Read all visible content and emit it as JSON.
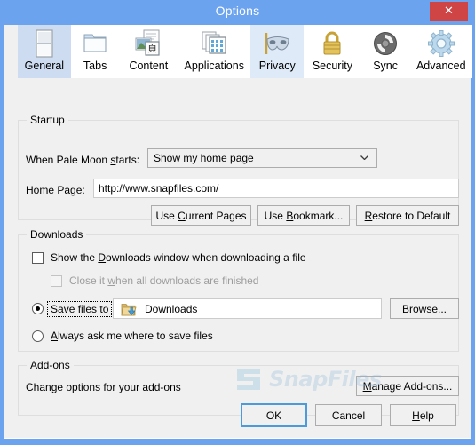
{
  "window": {
    "title": "Options",
    "close_label": "✕",
    "accent_titlebar": "#6ba3ef",
    "background": "#f0f0f0",
    "default_button_accent": "#4b9bdc",
    "close_button_color": "#cf4545"
  },
  "tabs": [
    {
      "label": "General",
      "icon": "general-page-icon",
      "state": "selected"
    },
    {
      "label": "Tabs",
      "icon": "folder-tabs-icon",
      "state": "normal"
    },
    {
      "label": "Content",
      "icon": "content-page-icon",
      "state": "normal"
    },
    {
      "label": "Applications",
      "icon": "applications-icon",
      "state": "normal"
    },
    {
      "label": "Privacy",
      "icon": "privacy-mask-icon",
      "state": "hover"
    },
    {
      "label": "Security",
      "icon": "security-lock-icon",
      "state": "normal"
    },
    {
      "label": "Sync",
      "icon": "sync-arrows-icon",
      "state": "normal"
    },
    {
      "label": "Advanced",
      "icon": "advanced-gear-icon",
      "state": "normal"
    }
  ],
  "startup": {
    "group_title": "Startup",
    "when_starts_label_pre": "When Pale Moon ",
    "when_starts_label_accel": "s",
    "when_starts_label_post": "tarts:",
    "startup_value": "Show my home page",
    "home_page_label_pre": "Home ",
    "home_page_label_accel": "P",
    "home_page_label_post": "age:",
    "home_page_value": "http://www.snapfiles.com/",
    "use_current_pages_pre": "Use ",
    "use_current_pages_accel": "C",
    "use_current_pages_post": "urrent Pages",
    "use_bookmark_pre": "Use ",
    "use_bookmark_accel": "B",
    "use_bookmark_post": "ookmark...",
    "restore_default_pre": "",
    "restore_default_accel": "R",
    "restore_default_post": "estore to Default"
  },
  "downloads": {
    "group_title": "Downloads",
    "show_window_pre": "Show the ",
    "show_window_accel": "D",
    "show_window_post": "ownloads window when downloading a file",
    "show_window_checked": false,
    "close_when_finished_pre": "Close it ",
    "close_when_finished_accel": "w",
    "close_when_finished_post": "hen all downloads are finished",
    "close_when_finished_checked": false,
    "close_when_finished_disabled": true,
    "save_files_to_pre": "Sa",
    "save_files_to_accel": "v",
    "save_files_to_post": "e files to",
    "save_files_to_selected": true,
    "download_folder": "Downloads",
    "folder_icon": "download-folder-icon",
    "browse_pre": "Br",
    "browse_accel": "o",
    "browse_post": "wse...",
    "always_ask_pre": "",
    "always_ask_accel": "A",
    "always_ask_post": "lways ask me where to save files",
    "always_ask_selected": false
  },
  "addons": {
    "group_title": "Add-ons",
    "description": "Change options for your add-ons",
    "manage_pre": "",
    "manage_accel": "M",
    "manage_post": "anage Add-ons..."
  },
  "footer": {
    "ok_label": "OK",
    "cancel_label": "Cancel",
    "help_pre": "",
    "help_accel": "H",
    "help_post": "elp"
  },
  "watermark": {
    "text": "SnapFiles"
  }
}
